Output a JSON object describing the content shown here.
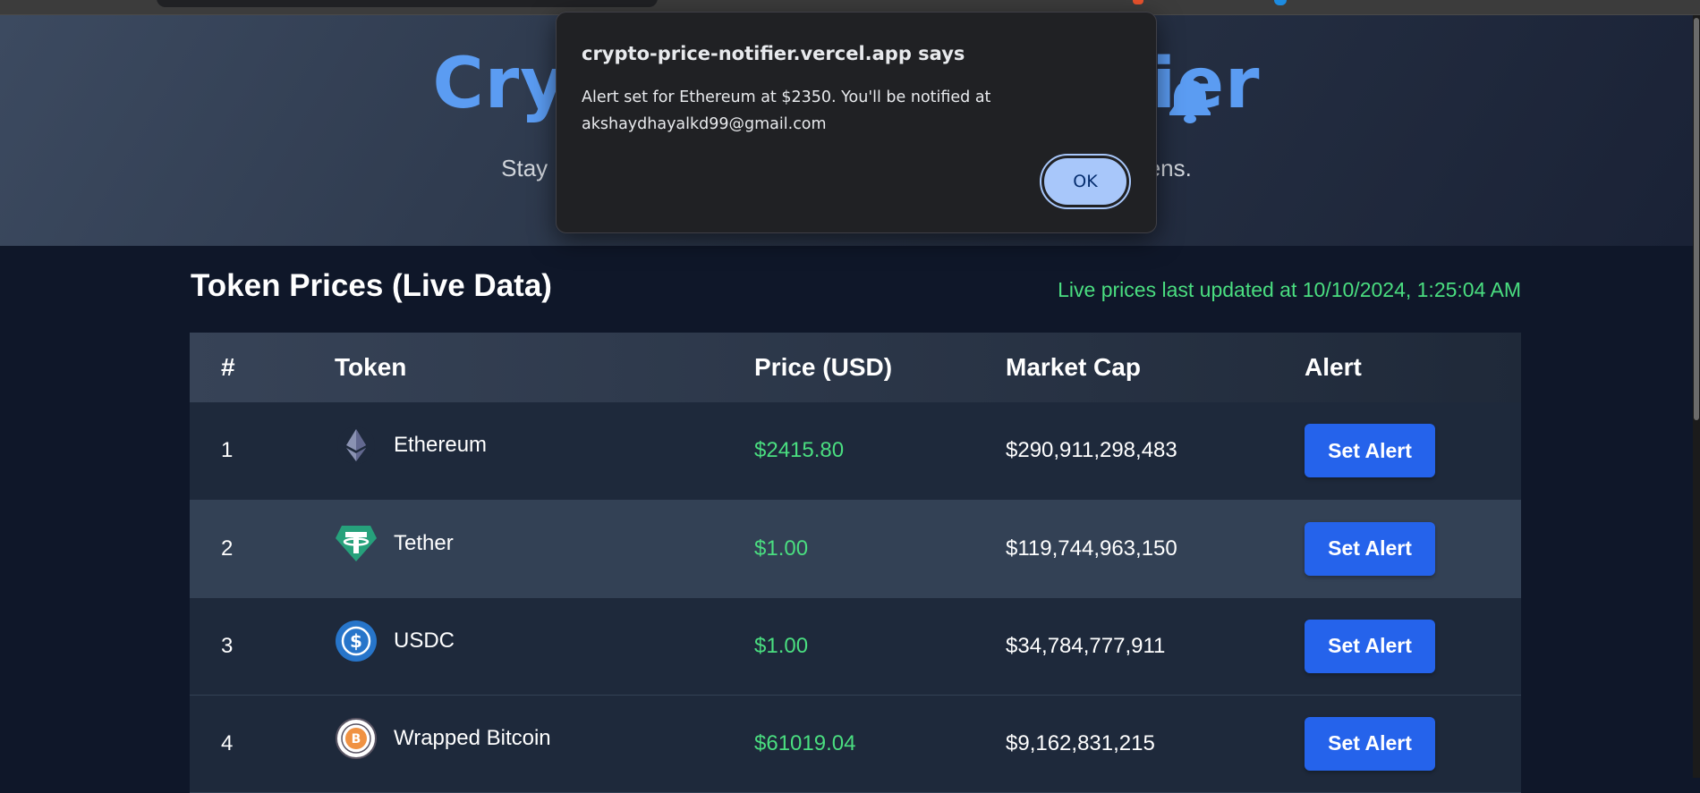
{
  "hero": {
    "title": "Crypto Price Notifier",
    "subtitle": "Stay updated with live prices and set alerts for your favorite tokens."
  },
  "section": {
    "title": "Token Prices (Live Data)",
    "updated": "Live prices last updated at 10/10/2024, 1:25:04 AM"
  },
  "table": {
    "headers": [
      "#",
      "Token",
      "Price (USD)",
      "Market Cap",
      "Alert"
    ],
    "rows": [
      {
        "rank": "1",
        "token": "Ethereum",
        "icon": "ethereum-icon",
        "price": "$2415.80",
        "market_cap": "$290,911,298,483",
        "alert_label": "Set Alert"
      },
      {
        "rank": "2",
        "token": "Tether",
        "icon": "tether-icon",
        "price": "$1.00",
        "market_cap": "$119,744,963,150",
        "alert_label": "Set Alert"
      },
      {
        "rank": "3",
        "token": "USDC",
        "icon": "usdc-icon",
        "price": "$1.00",
        "market_cap": "$34,784,777,911",
        "alert_label": "Set Alert"
      },
      {
        "rank": "4",
        "token": "Wrapped Bitcoin",
        "icon": "wrapped-bitcoin-icon",
        "price": "$61019.04",
        "market_cap": "$9,162,831,215",
        "alert_label": "Set Alert"
      }
    ]
  },
  "dialog": {
    "title": "crypto-price-notifier.vercel.app says",
    "message": "Alert set for Ethereum at $2350. You'll be notified at akshaydhayalkd99@gmail.com",
    "ok_label": "OK"
  },
  "colors": {
    "accent": "#2563eb",
    "price_green": "#4ade80",
    "title_blue": "#5b9cf2",
    "dialog_button": "#a8c7fa"
  }
}
